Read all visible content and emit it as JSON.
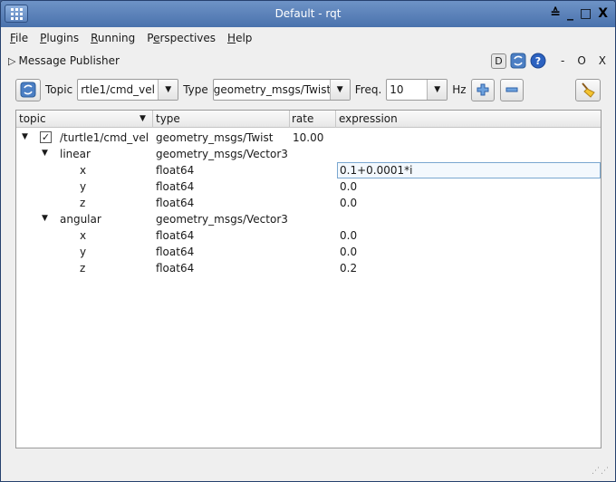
{
  "window": {
    "title": "Default - rqt"
  },
  "window_controls": [
    "≙",
    "_",
    "□",
    "X"
  ],
  "menubar": [
    {
      "label": "File",
      "u": "F",
      "rest": "ile"
    },
    {
      "label": "Plugins",
      "u": "P",
      "rest": "lugins"
    },
    {
      "label": "Running",
      "u": "R",
      "rest": "unning"
    },
    {
      "label": "Perspectives",
      "pre": "P",
      "u": "e",
      "rest": "rspectives"
    },
    {
      "label": "Help",
      "u": "H",
      "rest": "elp"
    }
  ],
  "plugin": {
    "title": "Message Publisher",
    "d_label": "D",
    "min_label": "-",
    "o_label": "O",
    "close_label": "X"
  },
  "toolbar": {
    "topic_label": "Topic",
    "topic_value": "rtle1/cmd_vel",
    "type_label": "Type",
    "type_value": "geometry_msgs/Twist",
    "freq_label": "Freq.",
    "freq_value": "10",
    "hz_label": "Hz"
  },
  "columns": [
    "topic",
    "type",
    "rate",
    "expression"
  ],
  "rows": [
    {
      "name": "/turtle1/cmd_vel",
      "type": "geometry_msgs/Twist",
      "rate": "10.00",
      "expression": ""
    },
    {
      "name": "linear",
      "type": "geometry_msgs/Vector3",
      "rate": "",
      "expression": ""
    },
    {
      "name": "x",
      "type": "float64",
      "rate": "",
      "expression": "0.1+0.0001*i"
    },
    {
      "name": "y",
      "type": "float64",
      "rate": "",
      "expression": "0.0"
    },
    {
      "name": "z",
      "type": "float64",
      "rate": "",
      "expression": "0.0"
    },
    {
      "name": "angular",
      "type": "geometry_msgs/Vector3",
      "rate": "",
      "expression": ""
    },
    {
      "name": "x",
      "type": "float64",
      "rate": "",
      "expression": "0.0"
    },
    {
      "name": "y",
      "type": "float64",
      "rate": "",
      "expression": "0.0"
    },
    {
      "name": "z",
      "type": "float64",
      "rate": "",
      "expression": "0.2"
    }
  ],
  "colors": {
    "titlebar": "#5a80b9",
    "selection_border": "#7aa7d0"
  }
}
